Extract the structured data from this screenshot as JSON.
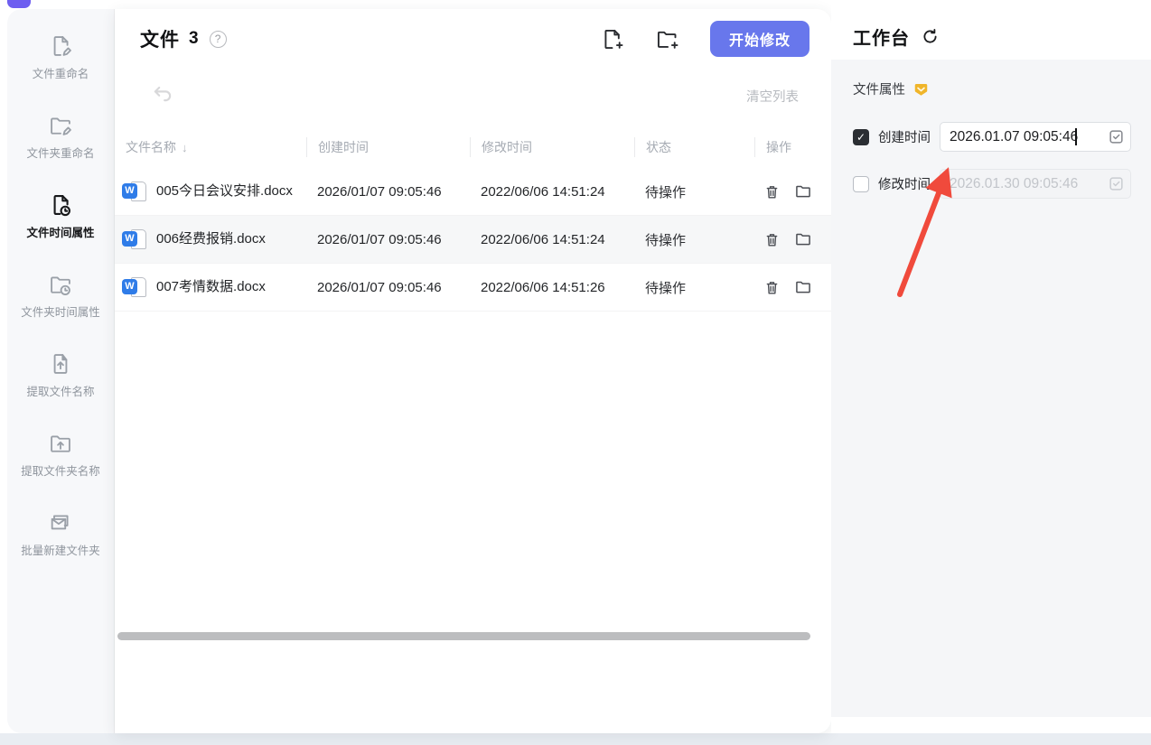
{
  "sidebar": {
    "items": [
      {
        "label": "文件重命名",
        "icon": "file-rename-icon",
        "active": false
      },
      {
        "label": "文件夹重命名",
        "icon": "folder-rename-icon",
        "active": false
      },
      {
        "label": "文件时间属性",
        "icon": "file-time-icon",
        "active": true
      },
      {
        "label": "文件夹时间属性",
        "icon": "folder-time-icon",
        "active": false
      },
      {
        "label": "提取文件名称",
        "icon": "extract-file-name-icon",
        "active": false
      },
      {
        "label": "提取文件夹名称",
        "icon": "extract-folder-name-icon",
        "active": false
      },
      {
        "label": "批量新建文件夹",
        "icon": "batch-new-folder-icon",
        "active": false
      }
    ]
  },
  "main": {
    "title": "文件",
    "count": "3",
    "help": "?",
    "toolbar": {
      "start_button": "开始修改",
      "clear_list": "清空列表"
    },
    "table": {
      "headers": {
        "name": "文件名称",
        "created": "创建时间",
        "modified": "修改时间",
        "status": "状态",
        "ops": "操作"
      },
      "sort_arrow": "↓",
      "rows": [
        {
          "name": "005今日会议安排.docx",
          "created": "2026/01/07 09:05:46",
          "modified": "2022/06/06 14:51:24",
          "status": "待操作"
        },
        {
          "name": "006经费报销.docx",
          "created": "2026/01/07 09:05:46",
          "modified": "2022/06/06 14:51:24",
          "status": "待操作"
        },
        {
          "name": "007考情数据.docx",
          "created": "2026/01/07 09:05:46",
          "modified": "2022/06/06 14:51:26",
          "status": "待操作"
        }
      ],
      "file_type_badge": "W"
    }
  },
  "workbench": {
    "title": "工作台",
    "section": "文件属性",
    "create_time": {
      "label": "创建时间",
      "value": "2026.01.07 09:05:46",
      "checked": true
    },
    "modify_time": {
      "label": "修改时间",
      "value": "2026.01.30 09:05:46",
      "checked": false
    },
    "check_glyph": "✓"
  },
  "colors": {
    "accent_blue": "#6877ec",
    "arrow_red": "#f04a3c",
    "vip_gold": "#f0b52a",
    "row_alt": "#f6f7f8",
    "word_blue": "#2f7ce8"
  }
}
